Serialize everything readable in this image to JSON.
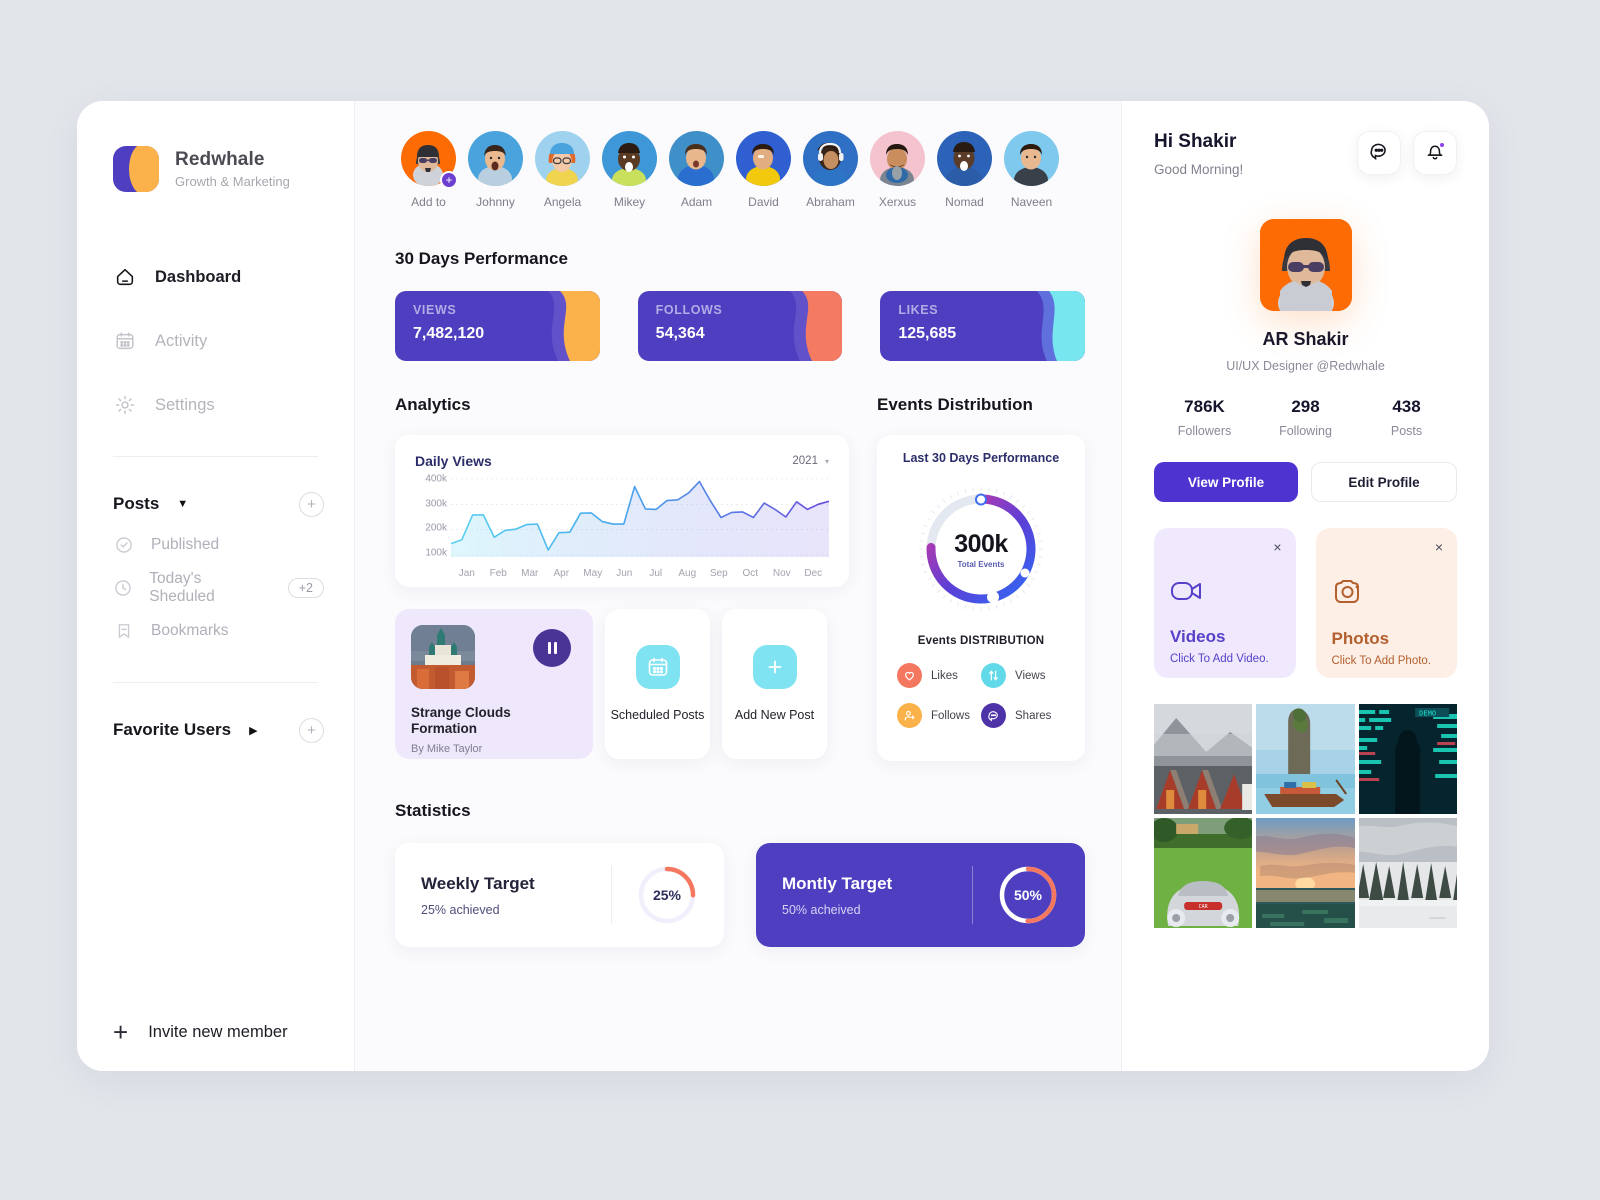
{
  "sidebar": {
    "brand": {
      "name": "Redwhale",
      "subtitle": "Growth & Marketing",
      "logo_icon": "redwhale-logo"
    },
    "nav": [
      {
        "label": "Dashboard",
        "icon": "home-icon",
        "active": true
      },
      {
        "label": "Activity",
        "icon": "calendar-icon",
        "active": false
      },
      {
        "label": "Settings",
        "icon": "gear-icon",
        "active": false
      }
    ],
    "posts_group": {
      "title": "Posts",
      "caret": "▼",
      "add_label": "+",
      "items": [
        {
          "label": "Published",
          "icon": "check-circle-icon",
          "badge": ""
        },
        {
          "label": "Today's Sheduled",
          "icon": "clock-icon",
          "badge": "+2"
        },
        {
          "label": "Bookmarks",
          "icon": "bookmark-icon",
          "badge": ""
        }
      ]
    },
    "favorite_users": {
      "title": "Favorite Users",
      "caret": "▶",
      "add_label": "+"
    },
    "invite": {
      "label": "Invite new member",
      "icon": "plus-icon"
    }
  },
  "main": {
    "avatars": [
      {
        "name": "Add to",
        "bg": "#fc6b04",
        "add": true
      },
      {
        "name": "Johnny",
        "bg": "#4aa3dd",
        "add": false
      },
      {
        "name": "Angela",
        "bg": "#8ec7e8",
        "add": false
      },
      {
        "name": "Mikey",
        "bg": "#3e97d6",
        "add": false
      },
      {
        "name": "Adam",
        "bg": "#3f8fc9",
        "add": false
      },
      {
        "name": "David",
        "bg": "#2f5fd0",
        "add": false
      },
      {
        "name": "Abraham",
        "bg": "#2f6fc4",
        "add": false
      },
      {
        "name": "Xerxus",
        "bg": "#f4c3cd",
        "add": false
      },
      {
        "name": "Nomad",
        "bg": "#2c63b8",
        "add": false
      },
      {
        "name": "Naveen",
        "bg": "#7fc9ef",
        "add": false
      }
    ],
    "performance": {
      "title": "30 Days Performance",
      "cards": [
        {
          "label": "VIEWS",
          "value": "7,482,120",
          "accent": "#fbb24b"
        },
        {
          "label": "FOLLOWS",
          "value": "54,364",
          "accent": "#f47b62"
        },
        {
          "label": "LIKES",
          "value": "125,685",
          "accent": "#78e6ee"
        }
      ]
    },
    "analytics": {
      "title": "Analytics",
      "card_title": "Daily Views",
      "year": "2021"
    },
    "events": {
      "title": "Events Distribution",
      "card_title": "Last 30 Days Performance",
      "total_value": "300k",
      "total_label": "Total Events",
      "dist_label": "Events DISTRIBUTION",
      "legend": [
        {
          "label": "Likes",
          "color": "#f4785f",
          "icon": "heart-icon"
        },
        {
          "label": "Views",
          "color": "#62d9e8",
          "icon": "updown-arrows-icon"
        },
        {
          "label": "Follows",
          "color": "#fbb24b",
          "icon": "user-plus-icon"
        },
        {
          "label": "Shares",
          "color": "#4e33a8",
          "icon": "chat-bubble-icon"
        }
      ]
    },
    "posts": {
      "feature": {
        "title": "Strange Clouds Formation",
        "author": "By Mike Taylor",
        "action_icon": "pause-icon"
      },
      "scheduled": {
        "label": "Scheduled Posts",
        "icon": "calendar-icon"
      },
      "add_new": {
        "label": "Add New Post",
        "icon": "plus-icon"
      }
    },
    "statistics": {
      "title": "Statistics",
      "cards": [
        {
          "title": "Weekly Target",
          "sub": "25% achieved",
          "percent_label": "25%",
          "percent": 25,
          "ring_color": "#f4785f",
          "theme": "white"
        },
        {
          "title": "Montly Target",
          "sub": "50% acheived",
          "percent_label": "50%",
          "percent": 50,
          "ring_color": "#f4785f",
          "theme": "purple"
        }
      ]
    }
  },
  "right": {
    "greeting": {
      "hi": "Hi Shakir",
      "sub": "Good Morning!"
    },
    "icon_buttons": [
      {
        "name": "messages-icon"
      },
      {
        "name": "notification-bell-icon"
      }
    ],
    "profile": {
      "name": "AR Shakir",
      "role": "UI/UX Designer @Redwhale",
      "stats": [
        {
          "value": "786K",
          "label": "Followers"
        },
        {
          "value": "298",
          "label": "Following"
        },
        {
          "value": "438",
          "label": "Posts"
        }
      ],
      "view_button": "View Profile",
      "edit_button": "Edit Profile"
    },
    "media": [
      {
        "title": "Videos",
        "sub": "Click To Add Video.",
        "icon": "video-camera-icon",
        "close": "×"
      },
      {
        "title": "Photos",
        "sub": "Click To Add Photo.",
        "icon": "camera-icon",
        "close": "×"
      }
    ],
    "photo_grid": [
      {
        "name": "cabins-mountain-photo"
      },
      {
        "name": "thailand-boat-photo"
      },
      {
        "name": "arcade-screens-photo"
      },
      {
        "name": "classic-car-photo"
      },
      {
        "name": "ocean-sunset-photo"
      },
      {
        "name": "snow-forest-photo"
      }
    ]
  },
  "chart_data": {
    "type": "area",
    "title": "Daily Views",
    "xlabel": "",
    "ylabel": "",
    "ylim": [
      100000,
      400000
    ],
    "ytick_labels": [
      "400k",
      "300k",
      "200k",
      "100k"
    ],
    "ytick_values": [
      400000,
      300000,
      200000,
      100000
    ],
    "categories": [
      "Jan",
      "Feb",
      "Mar",
      "Apr",
      "May",
      "Jun",
      "Jul",
      "Aug",
      "Sep",
      "Oct",
      "Nov",
      "Dec"
    ],
    "grid": true,
    "legend": "none",
    "series": [
      {
        "name": "Daily Views",
        "x": [
          0,
          1,
          2,
          3,
          4,
          5,
          6,
          7,
          8,
          9,
          10,
          11,
          12,
          13,
          14,
          15,
          16,
          17,
          18,
          19,
          20,
          21,
          22,
          23,
          24,
          25,
          26,
          27,
          28,
          29,
          30,
          31,
          32,
          33,
          34,
          35
        ],
        "values": [
          145000,
          160000,
          258000,
          258000,
          170000,
          197000,
          202000,
          220000,
          222000,
          120000,
          188000,
          190000,
          265000,
          266000,
          232000,
          222000,
          222000,
          370000,
          282000,
          280000,
          315000,
          318000,
          345000,
          390000,
          315000,
          248000,
          268000,
          270000,
          248000,
          305000,
          280000,
          250000,
          310000,
          280000,
          300000,
          312000
        ]
      }
    ]
  }
}
